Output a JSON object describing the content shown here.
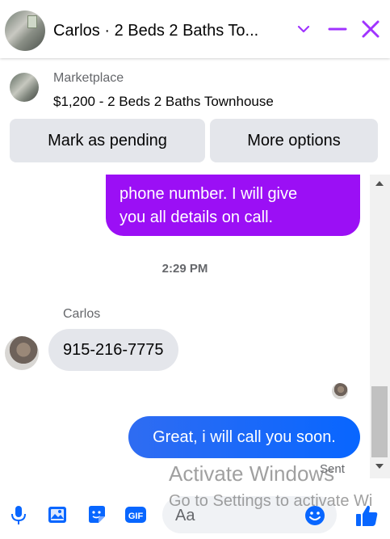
{
  "header": {
    "title": "Carlos · 2 Beds 2 Baths To...",
    "icons": [
      "chevron-down-icon",
      "minimize-icon",
      "close-icon"
    ],
    "accent": "#a033ff"
  },
  "listing": {
    "label": "Marketplace",
    "title": "$1,200 - 2 Beds 2 Baths Townhouse",
    "buttons": {
      "pending": "Mark as pending",
      "more": "More options"
    }
  },
  "messages": {
    "outgoing_partial": {
      "line1": "phone number. I will give",
      "line2": "you all details on call.",
      "color": "#9b0ff5"
    },
    "timestamp": "2:29 PM",
    "sender_name": "Carlos",
    "incoming": "915-216-7775",
    "outgoing": "Great, i will call you soon.",
    "outgoing_color": "#0866ff",
    "status": "Sent"
  },
  "composer": {
    "placeholder": "Aa",
    "icons": [
      "microphone-icon",
      "photo-icon",
      "sticker-icon",
      "gif-icon",
      "emoji-icon",
      "like-icon"
    ],
    "accent": "#0866ff"
  },
  "watermark": {
    "line1": "Activate Windows",
    "line2": "Go to Settings to activate Wi"
  }
}
